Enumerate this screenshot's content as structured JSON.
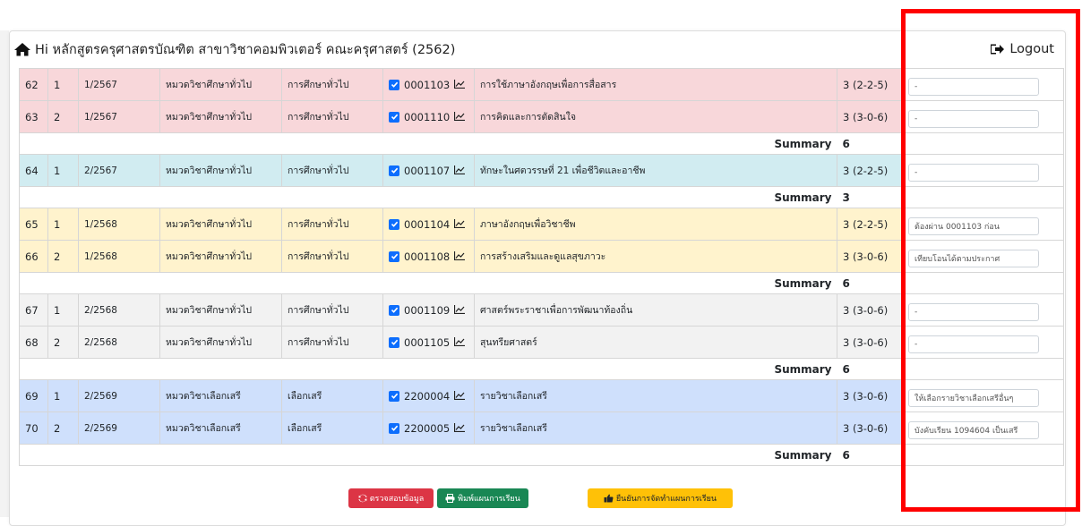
{
  "header": {
    "title": "Hi หลักสูตรครุศาสตรบัณฑิต สาขาวิชาคอมพิวเตอร์ คณะครุศาสตร์ (2562)",
    "logout_label": "Logout"
  },
  "table": {
    "summary_label": "Summary",
    "groups": [
      {
        "color": "pink",
        "summary": "6",
        "rows": [
          {
            "no": "62",
            "seq": "1",
            "term": "1/2567",
            "group": "หมวดวิชาศึกษาทั่วไป",
            "type": "การศึกษาทั่วไป",
            "code": "0001103",
            "name": "การใช้ภาษาอังกฤษเพื่อการสื่อสาร",
            "credit": "3 (2-2-5)",
            "remark": "-"
          },
          {
            "no": "63",
            "seq": "2",
            "term": "1/2567",
            "group": "หมวดวิชาศึกษาทั่วไป",
            "type": "การศึกษาทั่วไป",
            "code": "0001110",
            "name": "การคิดและการตัดสินใจ",
            "credit": "3 (3-0-6)",
            "remark": "-"
          }
        ]
      },
      {
        "color": "cyan",
        "summary": "3",
        "rows": [
          {
            "no": "64",
            "seq": "1",
            "term": "2/2567",
            "group": "หมวดวิชาศึกษาทั่วไป",
            "type": "การศึกษาทั่วไป",
            "code": "0001107",
            "name": "ทักษะในศตวรรษที่ 21 เพื่อชีวิตและอาชีพ",
            "credit": "3 (2-2-5)",
            "remark": "-"
          }
        ]
      },
      {
        "color": "yellow",
        "summary": "6",
        "rows": [
          {
            "no": "65",
            "seq": "1",
            "term": "1/2568",
            "group": "หมวดวิชาศึกษาทั่วไป",
            "type": "การศึกษาทั่วไป",
            "code": "0001104",
            "name": "ภาษาอังกฤษเพื่อวิชาชีพ",
            "credit": "3 (2-2-5)",
            "remark": "ต้องผ่าน 0001103 ก่อน"
          },
          {
            "no": "66",
            "seq": "2",
            "term": "1/2568",
            "group": "หมวดวิชาศึกษาทั่วไป",
            "type": "การศึกษาทั่วไป",
            "code": "0001108",
            "name": "การสร้างเสริมและดูแลสุขภาวะ",
            "credit": "3 (3-0-6)",
            "remark": "เทียบโอนได้ตามประกาศ"
          }
        ]
      },
      {
        "color": "gray",
        "summary": "6",
        "rows": [
          {
            "no": "67",
            "seq": "1",
            "term": "2/2568",
            "group": "หมวดวิชาศึกษาทั่วไป",
            "type": "การศึกษาทั่วไป",
            "code": "0001109",
            "name": "ศาสตร์พระราชาเพื่อการพัฒนาท้องถิ่น",
            "credit": "3 (3-0-6)",
            "remark": "-"
          },
          {
            "no": "68",
            "seq": "2",
            "term": "2/2568",
            "group": "หมวดวิชาศึกษาทั่วไป",
            "type": "การศึกษาทั่วไป",
            "code": "0001105",
            "name": "สุนทรียศาสตร์",
            "credit": "3 (3-0-6)",
            "remark": "-"
          }
        ]
      },
      {
        "color": "blue",
        "summary": "6",
        "rows": [
          {
            "no": "69",
            "seq": "1",
            "term": "2/2569",
            "group": "หมวดวิชาเลือกเสรี",
            "type": "เลือกเสรี",
            "code": "2200004",
            "name": "รายวิชาเลือกเสรี",
            "credit": "3 (3-0-6)",
            "remark": "ให้เลือกรายวิชาเลือกเสรีอื่นๆ"
          },
          {
            "no": "70",
            "seq": "2",
            "term": "2/2569",
            "group": "หมวดวิชาเลือกเสรี",
            "type": "เลือกเสรี",
            "code": "2200005",
            "name": "รายวิชาเลือกเสรี",
            "credit": "3 (3-0-6)",
            "remark": "บังคับเรียน 1094604 เป็นเสรี"
          }
        ]
      }
    ]
  },
  "buttons": {
    "verify": "ตรวจสอบข้อมูล",
    "print": "พิมพ์แผนการเรียน",
    "confirm": "ยืนยันการจัดทำแผนการเรียน"
  },
  "colors": {
    "pink": "#f8d7da",
    "cyan": "#d1ecf1",
    "yellow": "#fff3cd",
    "gray": "#f2f2f2",
    "blue": "#cfe0fc",
    "highlight_frame": "#ff0000"
  }
}
